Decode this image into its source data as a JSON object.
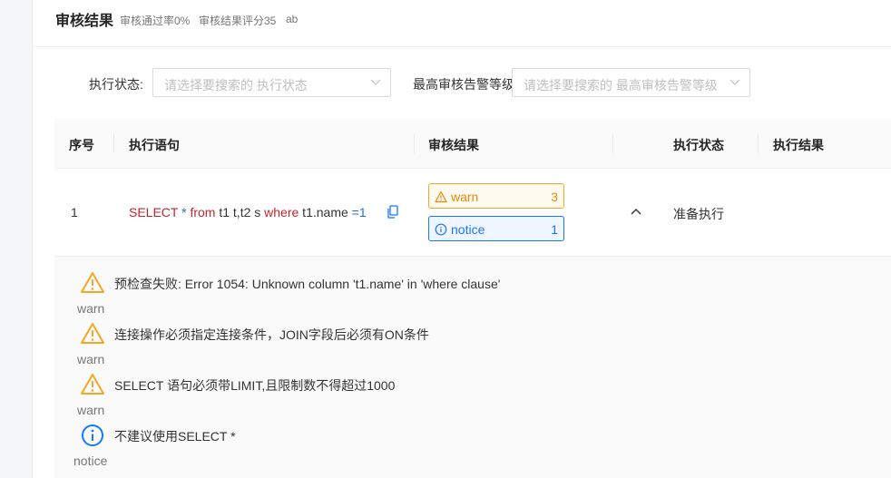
{
  "header": {
    "title": "审核结果",
    "pass_rate": "审核通过率0%",
    "score": "审核结果评分35",
    "extra": "ab"
  },
  "filters": {
    "exec_status_label": "执行状态:",
    "exec_status_placeholder": "请选择要搜索的 执行状态",
    "alert_level_label": "最高审核告警等级",
    "alert_level_placeholder": "请选择要搜索的 最高审核告警等级"
  },
  "table": {
    "columns": [
      "序号",
      "执行语句",
      "审核结果",
      "执行状态",
      "执行结果"
    ],
    "rows": [
      {
        "index": "1",
        "sql": {
          "t1": "SELECT",
          "t2": " * ",
          "t3": "from",
          "t4": " t1 t,t2 s ",
          "t5": "where",
          "t6": " t1.name ",
          "t7": "=1"
        },
        "warn_tag": {
          "label": "warn",
          "count": "3"
        },
        "notice_tag": {
          "label": "notice",
          "count": "1"
        },
        "exec_status": "准备执行",
        "exec_result": ""
      }
    ]
  },
  "issues": [
    {
      "level": "warn",
      "icon": "warning-icon",
      "message": "预检查失败: Error 1054: Unknown column 't1.name' in 'where clause'"
    },
    {
      "level": "warn",
      "icon": "warning-icon",
      "message": "连接操作必须指定连接条件，JOIN字段后必须有ON条件"
    },
    {
      "level": "warn",
      "icon": "warning-icon",
      "message": "SELECT 语句必须带LIMIT,且限制数不得超过1000"
    },
    {
      "level": "notice",
      "icon": "info-icon",
      "message": "不建议使用SELECT *"
    }
  ],
  "colors": {
    "warn": "#f5a623",
    "notice": "#1677ff",
    "keyword": "#c4262e",
    "operator": "#1f6fd1"
  }
}
